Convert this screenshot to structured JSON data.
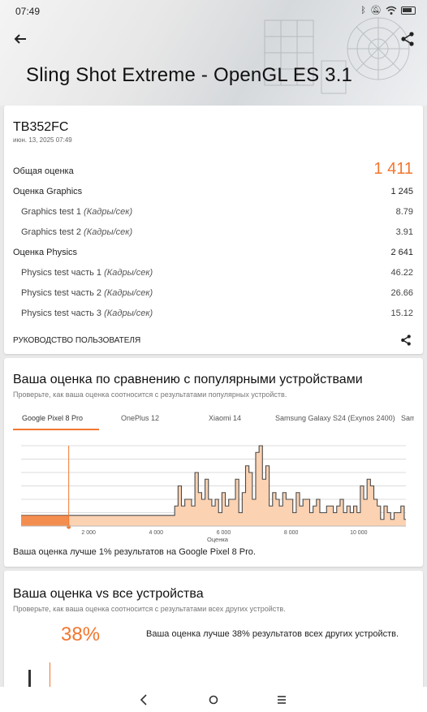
{
  "status": {
    "time": "07:49",
    "icons": [
      "bluetooth-icon",
      "mute-icon",
      "wifi-icon",
      "battery-icon"
    ]
  },
  "header": {
    "title": "Sling Shot Extreme - OpenGL ES 3.1"
  },
  "result": {
    "device": "TB352FC",
    "date": "июн. 13, 2025 07:49",
    "total_label": "Общая оценка",
    "total_value": "1 411",
    "graphics_label": "Оценка Graphics",
    "graphics_value": "1 245",
    "gt1_label": "Graphics test 1",
    "gt1_unit": "(Кадры/сек)",
    "gt1_value": "8.79",
    "gt2_label": "Graphics test 2",
    "gt2_unit": "(Кадры/сек)",
    "gt2_value": "3.91",
    "physics_label": "Оценка Physics",
    "physics_value": "2 641",
    "pt1_label": "Physics test часть 1",
    "pt1_unit": "(Кадры/сек)",
    "pt1_value": "46.22",
    "pt2_label": "Physics test часть 2",
    "pt2_unit": "(Кадры/сек)",
    "pt2_value": "26.66",
    "pt3_label": "Physics test часть 3",
    "pt3_unit": "(Кадры/сек)",
    "pt3_value": "15.12",
    "guide_label": "РУКОВОДСТВО ПОЛЬЗОВАТЕЛЯ"
  },
  "comparison": {
    "title": "Ваша оценка по сравнению с популярными устройствами",
    "subtitle": "Проверьте, как ваша оценка соотносится с результатами популярных устройств.",
    "tabs": [
      "Google Pixel 8 Pro",
      "OnePlus 12",
      "Xiaomi 14",
      "Samsung Galaxy S24 (Exynos 2400)",
      "Sam"
    ],
    "note": "Ваша оценка лучше 1% результатов на Google Pixel 8 Pro."
  },
  "chart_data": {
    "type": "area",
    "xlabel": "Оценка",
    "x_ticks": [
      "2 000",
      "4 000",
      "6 000",
      "8 000",
      "10 000"
    ],
    "x_tick_values": [
      2000,
      4000,
      6000,
      8000,
      10000
    ],
    "xlim": [
      0,
      11400
    ],
    "ylim": [
      0,
      12
    ],
    "your_score": 1411,
    "grid": true,
    "colors": {
      "fill": "#fbd2b2",
      "line": "#4a4a4a",
      "marker": "#f2772f"
    },
    "x": [
      0,
      1411,
      4550,
      4650,
      4750,
      4850,
      4950,
      5050,
      5150,
      5250,
      5350,
      5450,
      5550,
      5650,
      5750,
      5850,
      5950,
      6050,
      6150,
      6250,
      6350,
      6450,
      6550,
      6650,
      6750,
      6850,
      6950,
      7050,
      7150,
      7250,
      7350,
      7450,
      7550,
      7650,
      7750,
      7850,
      7950,
      8050,
      8150,
      8250,
      8350,
      8450,
      8550,
      8650,
      8750,
      8850,
      8950,
      9050,
      9150,
      9250,
      9350,
      9450,
      9550,
      9650,
      9750,
      9850,
      9950,
      10050,
      10150,
      10250,
      10350,
      10450,
      10550,
      10650,
      10750,
      10850,
      10950,
      11050,
      11150,
      11250,
      11350
    ],
    "values": [
      1.6,
      1.6,
      3,
      6,
      3,
      4,
      4,
      3,
      8,
      5,
      4,
      7,
      4,
      3,
      4,
      2,
      5,
      3,
      4,
      4,
      7,
      2,
      5,
      9,
      8,
      4,
      11,
      12,
      7,
      9,
      3,
      5,
      4,
      3,
      5,
      4,
      4,
      2,
      5,
      3,
      4,
      4,
      2,
      3,
      4,
      2,
      2,
      3,
      3,
      2,
      3,
      4,
      2,
      3,
      2,
      3,
      2,
      6,
      4,
      7,
      6,
      4,
      3,
      1,
      3,
      2,
      1,
      2,
      2,
      3,
      1
    ]
  },
  "all_devices": {
    "title": "Ваша оценка vs все устройства",
    "subtitle": "Проверьте, как ваша оценка соотносится с результатами всех других устройств.",
    "percent": "38%",
    "note": "Ваша оценка лучше 38% результатов всех других устройств."
  },
  "nav": {
    "icons": [
      "back-nav-icon",
      "home-nav-icon",
      "recents-nav-icon"
    ]
  }
}
